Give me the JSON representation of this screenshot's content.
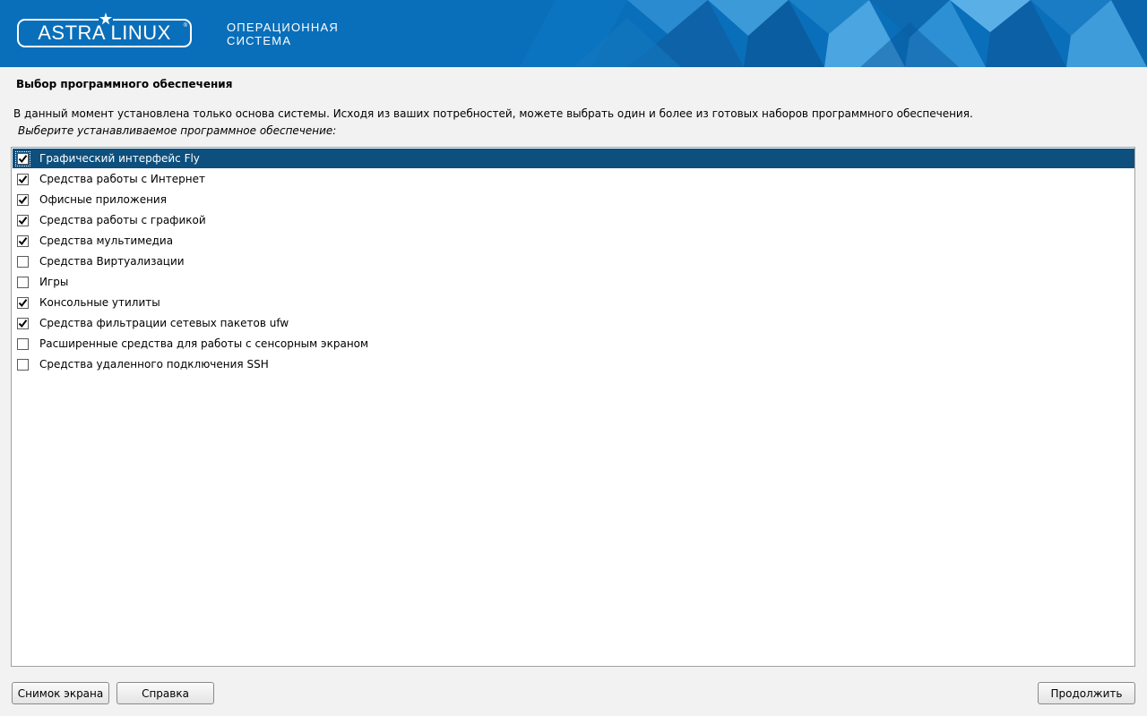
{
  "header": {
    "logo_text": "ASTRA LINUX",
    "logo_mark": "®",
    "tagline_line1": "ОПЕРАЦИОННАЯ",
    "tagline_line2": "СИСТЕМА",
    "colors": {
      "background": "#0a6fba",
      "text": "#ffffff"
    },
    "logo_icon": "star-icon"
  },
  "page": {
    "title": "Выбор программного обеспечения",
    "description": "В данный момент установлена только основа системы. Исходя из ваших потребностей, можете выбрать один и более из готовых наборов программного обеспечения.",
    "prompt": "Выберите устанавливаемое программное обеспечение:"
  },
  "software_list": {
    "selected_color": "#0d4f7d",
    "items": [
      {
        "label": "Графический интерфейс Fly",
        "checked": true,
        "selected": true
      },
      {
        "label": "Средства работы с Интернет",
        "checked": true,
        "selected": false
      },
      {
        "label": "Офисные приложения",
        "checked": true,
        "selected": false
      },
      {
        "label": "Средства работы с графикой",
        "checked": true,
        "selected": false
      },
      {
        "label": "Средства мультимедиа",
        "checked": true,
        "selected": false
      },
      {
        "label": "Средства Виртуализации",
        "checked": false,
        "selected": false
      },
      {
        "label": "Игры",
        "checked": false,
        "selected": false
      },
      {
        "label": "Консольные утилиты",
        "checked": true,
        "selected": false
      },
      {
        "label": "Средства фильтрации сетевых пакетов ufw",
        "checked": true,
        "selected": false
      },
      {
        "label": "Расширенные средства для работы с сенсорным экраном",
        "checked": false,
        "selected": false
      },
      {
        "label": "Средства удаленного подключения SSH",
        "checked": false,
        "selected": false
      }
    ]
  },
  "buttons": {
    "screenshot": "Снимок экрана",
    "help": "Справка",
    "continue": "Продолжить"
  }
}
